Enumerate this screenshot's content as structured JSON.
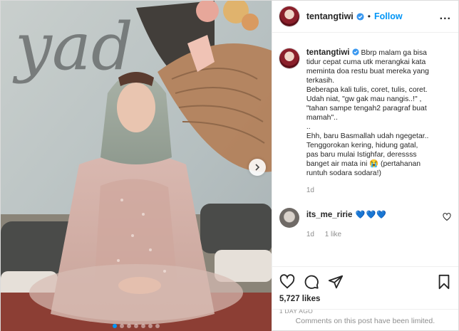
{
  "post": {
    "username": "tentangtiwi",
    "follow_label": "Follow",
    "more_glyph": "...",
    "bullet": "•",
    "caption_lines": [
      "Bbrp malam ga bisa",
      "tidur cepat cuma utk merangkai kata",
      "meminta doa restu buat mereka yang",
      "terkasih.",
      "Beberapa kali tulis, coret, tulis, coret.",
      "Udah niat, \"gw gak mau nangis..!\" ,",
      "\"tahan sampe tengah2 paragraf buat",
      "mamah\"..",
      "..",
      "Ehh, baru Basmallah udah ngegetar..",
      "Tenggorokan kering, hidung gatal,",
      "pas baru mulai Istighfar, deressss",
      "banget air mata ini 😭 (pertahanan",
      "runtuh sodara sodara!)"
    ],
    "caption_age": "1d",
    "photo_text": "yad",
    "carousel": {
      "count": 7,
      "active_index": 0
    }
  },
  "comment": {
    "username": "its_me_ririe",
    "text": "💙💙💙",
    "age": "1d",
    "likes": "1 like"
  },
  "actions": {
    "likes": "5,727 likes",
    "timestamp": "1 DAY AGO",
    "comments_limited": "Comments on this post have been limited."
  },
  "icons": {
    "verified": "verified-badge-icon",
    "next": "chevron-right-icon",
    "heart": "heart-icon",
    "comment": "comment-icon",
    "share": "send-icon",
    "save": "bookmark-icon"
  },
  "colors": {
    "accent": "#0095f6",
    "text": "#262626",
    "muted": "#8e8e8e"
  }
}
